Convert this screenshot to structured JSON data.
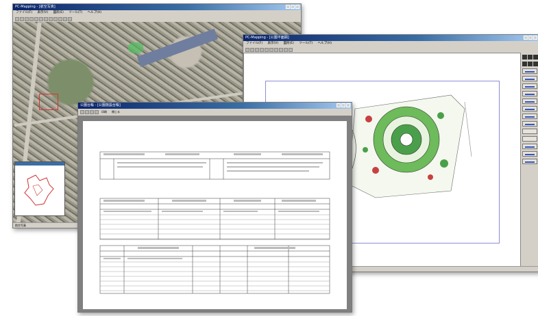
{
  "windows": {
    "aerial": {
      "title": "PC-Mapping - [航空写真]",
      "menus": [
        "ファイル(F)",
        "表示(V)",
        "図形(E)",
        "ツール(T)",
        "ヘルプ(H)"
      ],
      "status": "航空写真"
    },
    "cad": {
      "title": "PC-Mapping - [公園平面図]",
      "menus": [
        "ファイル(F)",
        "表示(V)",
        "図形(E)",
        "ツール(T)",
        "ヘルプ(H)"
      ],
      "status_left": "",
      "status_mid": "",
      "status_right": ""
    },
    "form": {
      "title": "公園台帳 - [公園施設台帳]",
      "toolbar_labels": [
        "印刷",
        "閉じる"
      ]
    }
  },
  "colors": {
    "titlebar": "#0a246a",
    "cad_frame": "#8c8cd8",
    "park_green": "#4aa04a",
    "inset_map_red": "#d03030"
  },
  "icons": [
    "window-minimize-icon",
    "window-maximize-icon",
    "window-close-icon",
    "toolbar-button-icon",
    "side-panel-button-icon"
  ]
}
